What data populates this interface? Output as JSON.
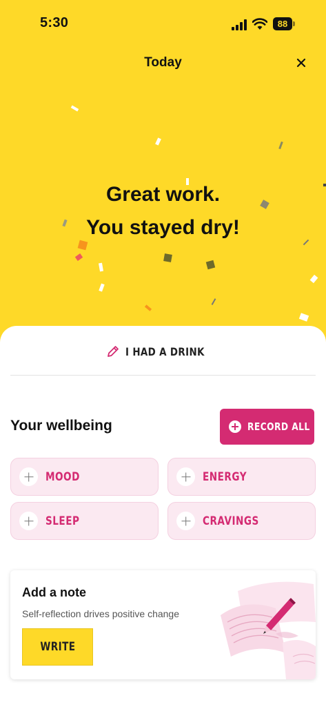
{
  "status_bar": {
    "time": "5:30",
    "battery": "88"
  },
  "header": {
    "title": "Today",
    "close_icon": "close-icon"
  },
  "hero": {
    "line1": "Great work.",
    "line2": "You stayed dry!",
    "background": "#FED928"
  },
  "drink": {
    "label": "I HAD A DRINK",
    "icon": "pencil-icon"
  },
  "wellbeing": {
    "title": "Your wellbeing",
    "record_all": "RECORD ALL",
    "tiles": [
      {
        "label": "MOOD"
      },
      {
        "label": "ENERGY"
      },
      {
        "label": "SLEEP"
      },
      {
        "label": "CRAVINGS"
      }
    ]
  },
  "note": {
    "title": "Add a note",
    "subtitle": "Self-reflection drives positive change",
    "write": "WRITE"
  },
  "colors": {
    "accent": "#D42B72",
    "yellow": "#FED928",
    "tile_bg": "#FBE9F1"
  }
}
